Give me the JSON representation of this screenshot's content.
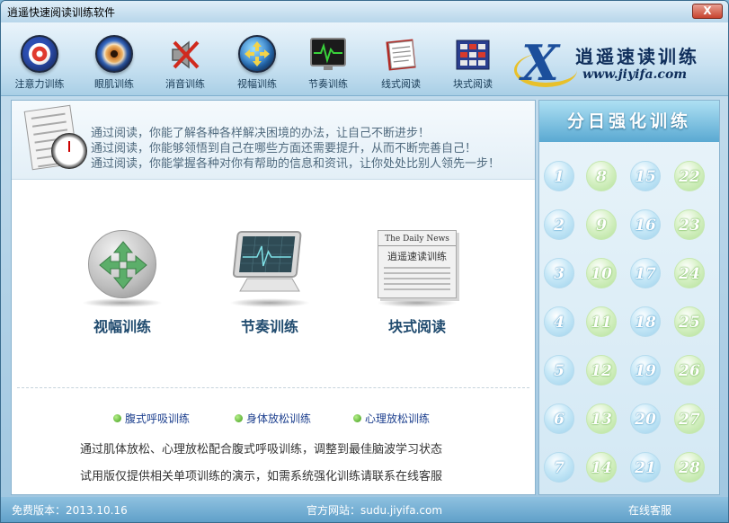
{
  "window": {
    "title": "逍遥快速阅读训练软件",
    "close_label": "X"
  },
  "toolbar": {
    "items": [
      {
        "label": "注意力训练",
        "icon": "target-icon"
      },
      {
        "label": "眼肌训练",
        "icon": "eye-icon"
      },
      {
        "label": "消音训练",
        "icon": "mute-icon"
      },
      {
        "label": "视幅训练",
        "icon": "expand-arrows-icon"
      },
      {
        "label": "节奏训练",
        "icon": "heartbeat-monitor-icon"
      },
      {
        "label": "线式阅读",
        "icon": "notebook-icon"
      },
      {
        "label": "块式阅读",
        "icon": "grid-blocks-icon"
      }
    ],
    "brand_name": "逍遥速读训练",
    "brand_url": "www.jiyifa.com"
  },
  "banner": {
    "lines": [
      "通过阅读，你能了解各种各样解决困境的办法，让自己不断进步！",
      "通过阅读，你能够领悟到自己在哪些方面还需要提升，从而不断完善自己！",
      "通过阅读，你能掌握各种对你有帮助的信息和资讯，让你处处比别人领先一步！"
    ]
  },
  "features": [
    {
      "label": "视幅训练"
    },
    {
      "label": "节奏训练"
    },
    {
      "label": "块式阅读",
      "paper_title": "The Daily News",
      "paper_text": "逍遥速读训练"
    }
  ],
  "links": [
    {
      "label": "腹式呼吸训练"
    },
    {
      "label": "身体放松训练"
    },
    {
      "label": "心理放松训练"
    }
  ],
  "descriptions": [
    "通过肌体放松、心理放松配合腹式呼吸训练，调整到最佳脑波学习状态",
    "试用版仅提供相关单项训练的演示，如需系统强化训练请联系在线客服"
  ],
  "sidebar": {
    "title": "分日强化训练",
    "days": [
      "1",
      "8",
      "15",
      "22",
      "2",
      "9",
      "16",
      "23",
      "3",
      "10",
      "17",
      "24",
      "4",
      "11",
      "18",
      "25",
      "5",
      "12",
      "19",
      "26",
      "6",
      "13",
      "20",
      "27",
      "7",
      "14",
      "21",
      "28"
    ]
  },
  "status": {
    "version": "免费版本：2013.10.16",
    "site": "官方网站：sudu.jiyifa.com",
    "support": "在线客服"
  }
}
